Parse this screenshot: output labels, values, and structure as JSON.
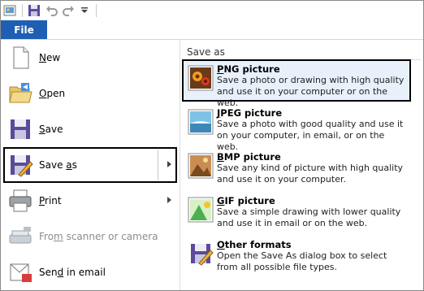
{
  "qat": {
    "icons": [
      "app-icon",
      "save-icon",
      "undo-icon",
      "redo-icon",
      "customize-dropdown-icon"
    ]
  },
  "ribbon": {
    "file_tab": "File"
  },
  "left_menu": {
    "items": [
      {
        "key": "N",
        "rest": "ew",
        "icon": "new-document-icon",
        "enabled": true,
        "has_submenu": false
      },
      {
        "key": "O",
        "rest": "pen",
        "icon": "open-folder-icon",
        "enabled": true,
        "has_submenu": false
      },
      {
        "key": "S",
        "rest": "ave",
        "icon": "save-disk-icon",
        "enabled": true,
        "has_submenu": false
      },
      {
        "pre": "Save ",
        "key": "a",
        "rest": "s",
        "icon": "save-as-icon",
        "enabled": true,
        "has_submenu": true,
        "selected": true
      },
      {
        "key": "P",
        "rest": "rint",
        "icon": "printer-icon",
        "enabled": true,
        "has_submenu": true
      },
      {
        "pre": "Fro",
        "key": "m",
        "rest": " scanner or camera",
        "icon": "scanner-icon",
        "enabled": false,
        "has_submenu": false
      },
      {
        "pre": "Sen",
        "key": "d",
        "rest": " in email",
        "icon": "email-icon",
        "enabled": true,
        "has_submenu": false
      }
    ]
  },
  "save_as_panel": {
    "title": "Save as",
    "items": [
      {
        "key": "P",
        "rest": "NG picture",
        "desc": "Save a photo or drawing with high quality and use it on your computer or on the web.",
        "icon": "png-picture-icon",
        "selected": true
      },
      {
        "key": "J",
        "rest": "PEG picture",
        "desc": "Save a photo with good quality and use it on your computer, in email, or on the web.",
        "icon": "jpeg-picture-icon"
      },
      {
        "key": "B",
        "rest": "MP picture",
        "desc": "Save any kind of picture with high quality and use it on your computer.",
        "icon": "bmp-picture-icon"
      },
      {
        "key": "G",
        "rest": "IF picture",
        "desc": "Save a simple drawing with lower quality and use it in email or on the web.",
        "icon": "gif-picture-icon"
      },
      {
        "key": "O",
        "rest": "ther formats",
        "desc": "Open the Save As dialog box to select from all possible file types.",
        "icon": "other-formats-icon"
      }
    ]
  }
}
